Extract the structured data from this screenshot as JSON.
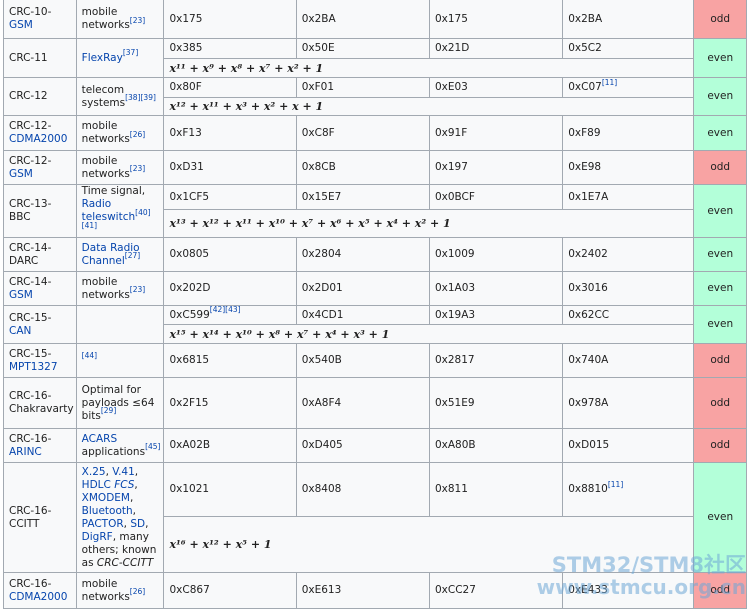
{
  "rows": [
    {
      "n1": "CRC-10-",
      "n2": "GSM",
      "u1": "mobile networks",
      "ref": "[23]",
      "h1": "0x175",
      "h2": "0x2BA",
      "h3": "0x175",
      "h4": "0x2BA",
      "p": "odd"
    },
    {
      "n1": "CRC-11",
      "u1": "FlexRay",
      "ref": "[37]",
      "h1": "0x385",
      "h2": "0x50E",
      "h3": "0x21D",
      "h4": "0x5C2",
      "poly": "x¹¹ + x⁹ + x⁸ + x⁷ + x² + 1",
      "p": "even"
    },
    {
      "n1": "CRC-12",
      "u1": "telecom systems",
      "ref": "[38][39]",
      "h1": "0x80F",
      "h2": "0xF01",
      "h3": "0xE03",
      "h4": "0xC07",
      "h4ref": "[11]",
      "poly": "x¹² + x¹¹ + x³ + x² + x + 1",
      "p": "even"
    },
    {
      "n1": "CRC-12-",
      "n2": "CDMA2000",
      "u1": "mobile networks",
      "ref": "[26]",
      "h1": "0xF13",
      "h2": "0xC8F",
      "h3": "0x91F",
      "h4": "0xF89",
      "p": "even"
    },
    {
      "n1": "CRC-12-",
      "n2": "GSM",
      "u1": "mobile networks",
      "ref": "[23]",
      "h1": "0xD31",
      "h2": "0x8CB",
      "h3": "0x197",
      "h4": "0xE98",
      "p": "odd"
    },
    {
      "n1": "CRC-13-BBC",
      "u1": "Time signal,",
      "u2": "Radio teleswitch",
      "ref": "[40][41]",
      "h1": "0x1CF5",
      "h2": "0x15E7",
      "h3": "0x0BCF",
      "h4": "0x1E7A",
      "poly": "x¹³ + x¹² + x¹¹ + x¹⁰ + x⁷ + x⁶ + x⁵ + x⁴ + x² + 1",
      "p": "even"
    },
    {
      "n1": "CRC-14-DARC",
      "u1": "Data Radio Channel",
      "ref": "[27]",
      "h1": "0x0805",
      "h2": "0x2804",
      "h3": "0x1009",
      "h4": "0x2402",
      "p": "even"
    },
    {
      "n1": "CRC-14-",
      "n2": "GSM",
      "u1": "mobile networks",
      "ref": "[23]",
      "h1": "0x202D",
      "h2": "0x2D01",
      "h3": "0x1A03",
      "h4": "0x3016",
      "p": "even"
    },
    {
      "n1": "CRC-15-",
      "n2": "CAN",
      "h1": "0xC599",
      "h1ref": "[42][43]",
      "h2": "0x4CD1",
      "h3": "0x19A3",
      "h4": "0x62CC",
      "poly": "x¹⁵ + x¹⁴ + x¹⁰ + x⁸ + x⁷ + x⁴ + x³ + 1",
      "p": "even"
    },
    {
      "n1": "CRC-15-",
      "n2": "MPT1327",
      "ref": "[44]",
      "h1": "0x6815",
      "h2": "0x540B",
      "h3": "0x2817",
      "h4": "0x740A",
      "p": "odd"
    },
    {
      "n1": "CRC-16-Chakravarty",
      "u1": "Optimal for payloads ≤64 bits",
      "ref": "[29]",
      "h1": "0x2F15",
      "h2": "0xA8F4",
      "h3": "0x51E9",
      "h4": "0x978A",
      "p": "odd"
    },
    {
      "n1": "CRC-16-",
      "n2": "ARINC",
      "u1": "ACARS",
      "u2": "applications",
      "ref": "[45]",
      "h1": "0xA02B",
      "h2": "0xD405",
      "h3": "0xA80B",
      "h4": "0xD015",
      "p": "odd"
    },
    {
      "n1": "CRC-16-CCITT",
      "u_links": [
        "X.25",
        "V.41",
        "HDLC"
      ],
      "u_fcs": "FCS",
      "u_links2": [
        "XMODEM",
        "Bluetooth",
        "PACTOR",
        "SD",
        "DigRF"
      ],
      "u_tail": "many others; known as",
      "u_it": "CRC-CCITT",
      "h1": "0x1021",
      "h2": "0x8408",
      "h3": "0x811",
      "h4": "0x8810",
      "h4ref": "[11]",
      "poly": "x¹⁶ + x¹² + x⁵ + 1",
      "p": "even"
    },
    {
      "n1": "CRC-16-",
      "n2": "CDMA2000",
      "u1": "mobile networks",
      "ref": "[26]",
      "h1": "0xC867",
      "h2": "0xE613",
      "h3": "0xCC27",
      "h4": "0xE433",
      "p": "odd"
    }
  ],
  "watermark": {
    "line1": "STM32/STM8社区",
    "line2": "www.stmcu.org.cn"
  },
  "colors": {
    "odd": "#ffb3b3",
    "even": "#b3ffd9",
    "link": "#0645ad",
    "border": "#a2a9b1",
    "cell": "#f8f9fa"
  }
}
